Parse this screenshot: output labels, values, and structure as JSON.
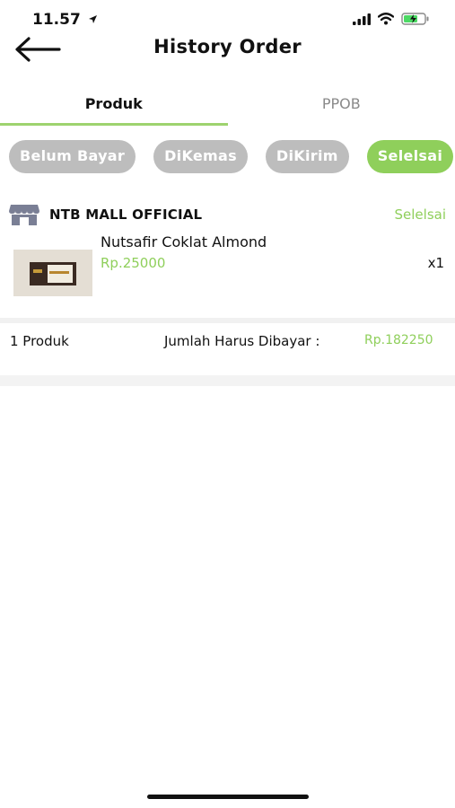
{
  "status_bar": {
    "time": "11.57",
    "icons": [
      "location-arrow-icon",
      "signal-icon",
      "wifi-icon",
      "battery-charging-icon"
    ]
  },
  "header": {
    "title": "History Order",
    "back_icon": "arrow-left-icon"
  },
  "tabs": [
    {
      "label": "Produk",
      "active": true
    },
    {
      "label": "PPOB",
      "active": false
    }
  ],
  "filters": [
    {
      "label": "Belum Bayar",
      "active": false
    },
    {
      "label": "DiKemas",
      "active": false
    },
    {
      "label": "DiKirim",
      "active": false
    },
    {
      "label": "Selelsai",
      "active": true
    }
  ],
  "order": {
    "store_icon": "store-icon",
    "store_name": "NTB MALL OFFICIAL",
    "status": "Selelsai",
    "product": {
      "name": "Nutsafir Coklat Almond",
      "price": "Rp.25000",
      "quantity": "x1"
    },
    "summary": {
      "count": "1 Produk",
      "total_label": "Jumlah Harus Dibayar :",
      "total_value": "Rp.182250"
    }
  },
  "colors": {
    "accent": "#8fcf5b",
    "chip_inactive": "#bdbdbd",
    "tab_underline": "#9ed36f"
  }
}
